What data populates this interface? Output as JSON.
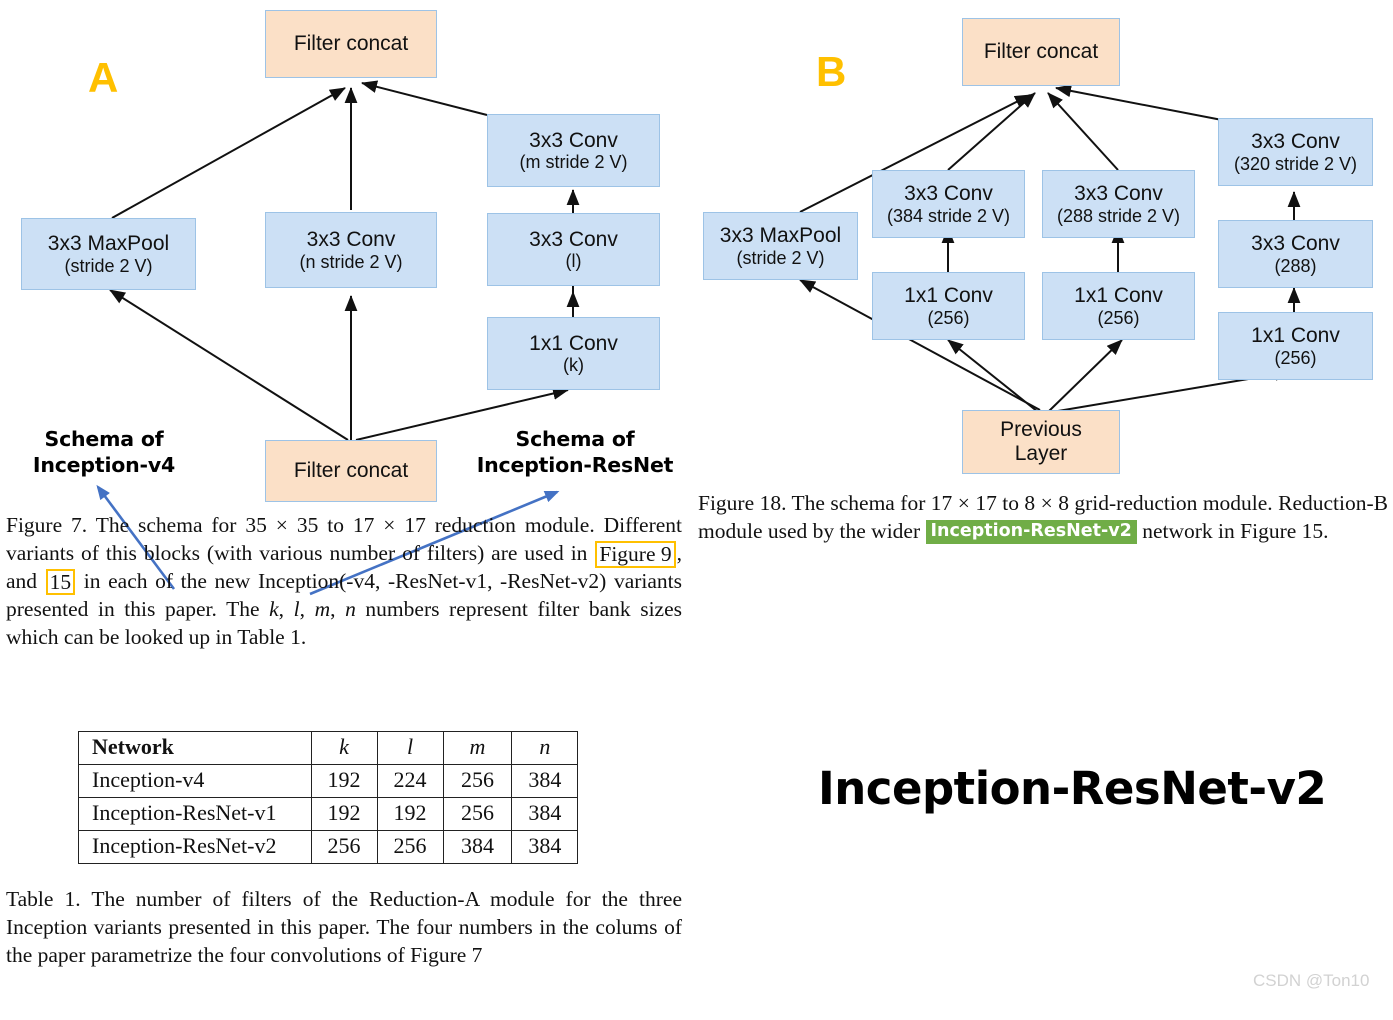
{
  "panels": {
    "a_letter": "A",
    "b_letter": "B"
  },
  "diagram_a": {
    "nodes": [
      {
        "id": "a-top-concat",
        "l1": "Filter concat",
        "l2": ""
      },
      {
        "id": "a-maxpool",
        "l1": "3x3 MaxPool",
        "l2": "(stride 2 V)"
      },
      {
        "id": "a-conv-mid",
        "l1": "3x3 Conv",
        "l2": "(n stride 2 V)"
      },
      {
        "id": "a-conv-m",
        "l1": "3x3 Conv",
        "l2": "(m stride 2 V)"
      },
      {
        "id": "a-conv-l",
        "l1": "3x3 Conv",
        "l2": "(l)"
      },
      {
        "id": "a-conv-k",
        "l1": "1x1 Conv",
        "l2": "(k)"
      },
      {
        "id": "a-bot-concat",
        "l1": "Filter concat",
        "l2": ""
      }
    ]
  },
  "diagram_b": {
    "nodes": [
      {
        "id": "b-top-concat",
        "l1": "Filter concat",
        "l2": ""
      },
      {
        "id": "b-maxpool",
        "l1": "3x3 MaxPool",
        "l2": "(stride 2 V)"
      },
      {
        "id": "b-conv-384",
        "l1": "3x3 Conv",
        "l2": "(384 stride 2 V)"
      },
      {
        "id": "b-conv-288s",
        "l1": "3x3 Conv",
        "l2": "(288 stride 2 V)"
      },
      {
        "id": "b-conv-320",
        "l1": "3x3 Conv",
        "l2": "(320 stride 2 V)"
      },
      {
        "id": "b-conv-288",
        "l1": "3x3 Conv",
        "l2": "(288)"
      },
      {
        "id": "b-1x1-left",
        "l1": "1x1 Conv",
        "l2": "(256)"
      },
      {
        "id": "b-1x1-mid",
        "l1": "1x1 Conv",
        "l2": "(256)"
      },
      {
        "id": "b-1x1-right",
        "l1": "1x1 Conv",
        "l2": "(256)"
      },
      {
        "id": "b-prev-layer",
        "l1": "Previous",
        "l2": "Layer"
      }
    ]
  },
  "annotations": {
    "schema_v4_line1": "Schema of",
    "schema_v4_line2": "Inception-v4",
    "schema_resnet_line1": "Schema of",
    "schema_resnet_line2": "Inception-ResNet"
  },
  "caption_fig7": {
    "part1": "Figure 7. The schema for 35 × 35 to 17 × 17 reduction module. Different variants of this blocks (with various number of filters) are used in ",
    "ref1": "Figure 9",
    "part2": ", and ",
    "ref2": "15",
    "part3": " in each of the new Inception(-v4, -ResNet-v1, -ResNet-v2) variants presented in this paper. The ",
    "sym_k": "k",
    "sep1": ", ",
    "sym_l": "l",
    "sep2": ", ",
    "sym_m": "m",
    "sep3": ", ",
    "sym_n": "n",
    "part4": " numbers represent filter bank sizes which can be looked up in Table 1."
  },
  "caption_fig18": {
    "part1": "Figure 18. The schema for 17 × 17 to 8 × 8 grid-reduction module. Reduction-B module used by the wider ",
    "badge": "Inception-ResNet-v2",
    "part2": " network in Figure 15."
  },
  "table": {
    "headers": [
      "Network",
      "k",
      "l",
      "m",
      "n"
    ],
    "rows": [
      {
        "network": "Inception-v4",
        "k": "192",
        "l": "224",
        "m": "256",
        "n": "384"
      },
      {
        "network": "Inception-ResNet-v1",
        "k": "192",
        "l": "192",
        "m": "256",
        "n": "384"
      },
      {
        "network": "Inception-ResNet-v2",
        "k": "256",
        "l": "256",
        "m": "384",
        "n": "384"
      }
    ]
  },
  "caption_table1": {
    "text": "Table 1. The number of filters of the Reduction-A module for the three Inception variants presented in this paper. The four numbers in the colums of the paper parametrize the four convolutions of Figure 7"
  },
  "big_title": "Inception-ResNet-v2",
  "watermark": "CSDN @Ton10",
  "colors": {
    "node_blue": "#CCE0F5",
    "node_peach": "#FBE0C7",
    "node_border": "#9DC3E6",
    "panel_letter": "#FFC000",
    "highlight_border": "#FFC000",
    "badge_green": "#70AD47",
    "annotation_arrow": "#4472C4",
    "edge": "#1a1a1a"
  }
}
